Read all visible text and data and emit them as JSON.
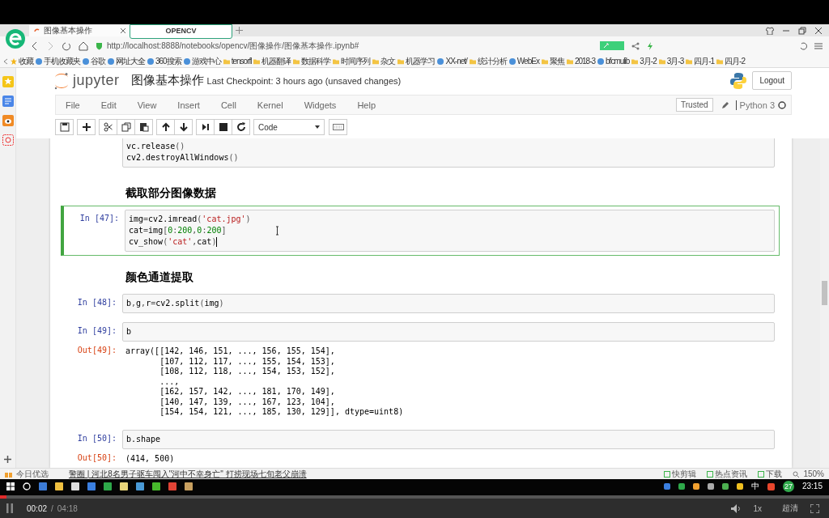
{
  "browser": {
    "tabs": [
      {
        "label": "图像基本操作",
        "selected": true
      }
    ],
    "tab_tooltip": "OPENCV",
    "url": "http://localhost:8888/notebooks/opencv/图像操作/图像基本操作.ipynb#",
    "bookmarks": [
      {
        "label": "收藏",
        "kind": "star"
      },
      {
        "label": "手机收藏夹",
        "kind": "site"
      },
      {
        "label": "谷歌",
        "kind": "site"
      },
      {
        "label": "网址大全",
        "kind": "site"
      },
      {
        "label": "360搜索",
        "kind": "site"
      },
      {
        "label": "游戏中心",
        "kind": "site"
      },
      {
        "label": "tensorfl",
        "kind": "folder"
      },
      {
        "label": "机器翻译",
        "kind": "folder"
      },
      {
        "label": "数据科学",
        "kind": "folder"
      },
      {
        "label": "时间序列",
        "kind": "folder"
      },
      {
        "label": "杂文",
        "kind": "folder"
      },
      {
        "label": "机器学习",
        "kind": "folder"
      },
      {
        "label": "XX-net/",
        "kind": "site"
      },
      {
        "label": "统计分析",
        "kind": "folder"
      },
      {
        "label": "WebEx",
        "kind": "site"
      },
      {
        "label": "聚焦",
        "kind": "folder"
      },
      {
        "label": "2018-3",
        "kind": "folder"
      },
      {
        "label": "bfcmulib",
        "kind": "site"
      },
      {
        "label": "3月-2",
        "kind": "folder"
      },
      {
        "label": "3月-3",
        "kind": "folder"
      },
      {
        "label": "四月-1",
        "kind": "folder"
      },
      {
        "label": "四月-2",
        "kind": "folder"
      }
    ],
    "status_left": "今日优选",
    "news": "警圈 | 河北8名男子驱车闯入\"河中不幸身亡\" 打捞现场七旬老父崩溃",
    "status_items": [
      "快剪辑",
      "热点资讯",
      "下载"
    ],
    "zoom": "150%"
  },
  "jupyter": {
    "logo_text": "jupyter",
    "title": "图像基本操作",
    "checkpoint": "Last Checkpoint: 3 hours ago (unsaved changes)",
    "logout": "Logout",
    "menu": [
      "File",
      "Edit",
      "View",
      "Insert",
      "Cell",
      "Kernel",
      "Widgets",
      "Help"
    ],
    "trusted": "Trusted",
    "kernel": "Python 3",
    "toolbar": [
      {
        "kind": "save"
      },
      {
        "kind": "add"
      },
      {
        "kind": "cut"
      },
      {
        "kind": "copy"
      },
      {
        "kind": "paste"
      },
      {
        "kind": "up"
      },
      {
        "kind": "down"
      },
      {
        "kind": "run"
      },
      {
        "kind": "stop"
      },
      {
        "kind": "restart"
      },
      {
        "kind": "select",
        "label": "Code"
      },
      {
        "kind": "keyboard"
      }
    ],
    "cells": [
      {
        "kind": "code",
        "selected": false,
        "lines": [
          "vc.release()",
          "cv2.destroyAllWindows()"
        ]
      },
      {
        "kind": "markdown",
        "selected": false,
        "text": "截取部分图像数据"
      },
      {
        "kind": "code",
        "selected": true,
        "prompt": "In [47]:",
        "lines": [
          "img=cv2.imread('cat.jpg')",
          "cat=img[0:200,0:200]",
          "cv_show('cat',cat)"
        ]
      },
      {
        "kind": "markdown",
        "selected": false,
        "text": "颜色通道提取"
      },
      {
        "kind": "code",
        "selected": false,
        "prompt": "In [48]:",
        "lines": [
          "b,g,r=cv2.split(img)"
        ]
      },
      {
        "kind": "code",
        "selected": false,
        "prompt": "In [49]:",
        "lines": [
          "b"
        ],
        "output": {
          "prompt": "Out[49]:",
          "lines": [
            "array([[142, 146, 151, ..., 156, 155, 154],",
            "       [107, 112, 117, ..., 155, 154, 153],",
            "       [108, 112, 118, ..., 154, 153, 152],",
            "       ...,",
            "       [162, 157, 142, ..., 181, 170, 149],",
            "       [140, 147, 139, ..., 167, 123, 104],",
            "       [154, 154, 121, ..., 185, 130, 129]], dtype=uint8)"
          ]
        }
      },
      {
        "kind": "code",
        "selected": false,
        "prompt": "In [50]:",
        "lines": [
          "b.shape"
        ],
        "output": {
          "prompt": "Out[50]:",
          "lines": [
            "(414, 500)"
          ]
        }
      }
    ]
  },
  "taskbar": {
    "input_method": "中",
    "badge": "27",
    "clock": "23:15"
  },
  "player": {
    "elapsed": "00:02",
    "separator": "/",
    "duration": "04:18",
    "speed": "1x",
    "quality": "超清",
    "level": 0.008
  }
}
